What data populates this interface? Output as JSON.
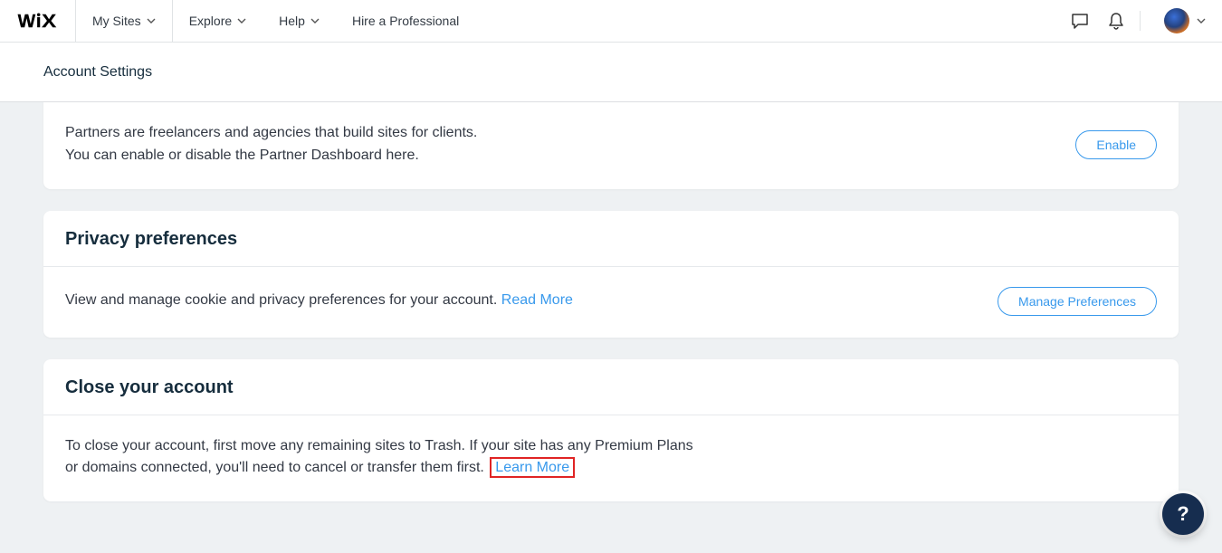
{
  "topnav": {
    "items": [
      "My Sites",
      "Explore",
      "Help",
      "Hire a Professional"
    ]
  },
  "secondbar": {
    "title": "Account Settings"
  },
  "partners": {
    "line1": "Partners are freelancers and agencies that build sites for clients.",
    "line2": "You can enable or disable the Partner Dashboard here.",
    "button": "Enable"
  },
  "privacy": {
    "title": "Privacy preferences",
    "text": "View and manage cookie and privacy preferences for your account. ",
    "link": "Read More",
    "button": "Manage Preferences"
  },
  "close": {
    "title": "Close your account",
    "line1": "To close your account, first move any remaining sites to Trash. If your site has any Premium Plans",
    "line2_pre": "or domains connected, you'll need to cancel or transfer them first.",
    "link": "Learn More"
  },
  "help_bubble": "?"
}
